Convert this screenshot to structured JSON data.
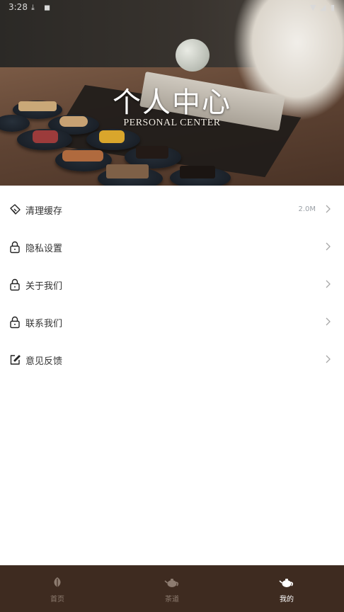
{
  "status_bar": {
    "time": "3:28"
  },
  "header": {
    "title": "个人中心",
    "subtitle": "PERSONAL CENTER"
  },
  "menu": {
    "items": [
      {
        "label": "清理缓存",
        "value": "2.0M",
        "icon": "broom-icon"
      },
      {
        "label": "隐私设置",
        "value": "",
        "icon": "lock-icon"
      },
      {
        "label": "关于我们",
        "value": "",
        "icon": "lock-icon"
      },
      {
        "label": "联系我们",
        "value": "",
        "icon": "lock-icon"
      },
      {
        "label": "意见反馈",
        "value": "",
        "icon": "edit-icon"
      }
    ]
  },
  "tabbar": {
    "tabs": [
      {
        "label": "首页",
        "icon": "tea-leaf-icon",
        "active": false
      },
      {
        "label": "茶道",
        "icon": "teapot-icon",
        "active": false
      },
      {
        "label": "我的",
        "icon": "teapot-icon",
        "active": true
      }
    ]
  },
  "colors": {
    "tabbar_bg": "#3e2b20",
    "tab_inactive": "#8d7c70",
    "tab_active": "#ffffff",
    "chevron": "#a7a7a7"
  }
}
